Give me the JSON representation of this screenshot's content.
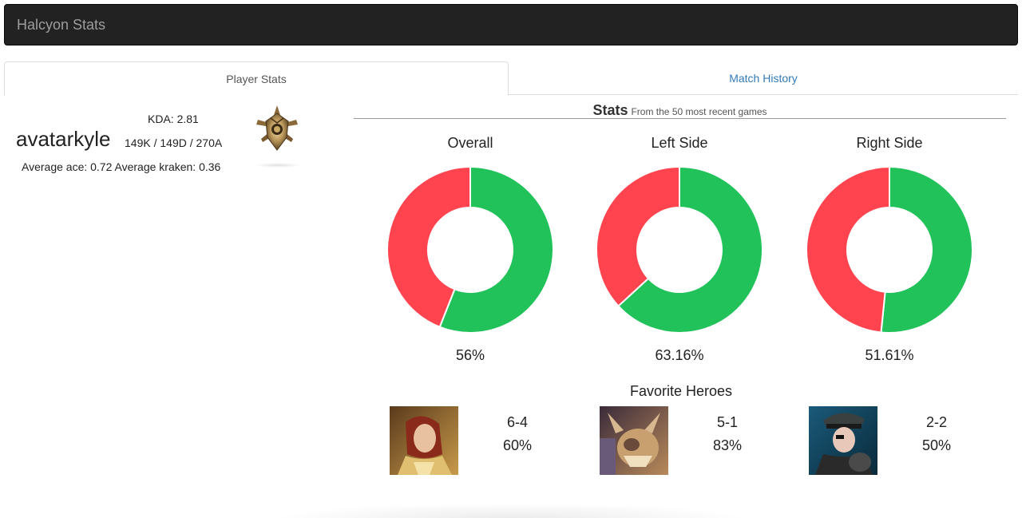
{
  "navbar": {
    "brand": "Halcyon Stats"
  },
  "tabs": [
    {
      "label": "Player Stats",
      "active": true
    },
    {
      "label": "Match History",
      "active": false
    }
  ],
  "player": {
    "name": "avatarkyle",
    "kda": "KDA: 2.81",
    "kills_deaths_assists": "149K / 149D / 270A",
    "averages": "Average ace: 0.72 Average kraken: 0.36",
    "tier_icon": "tier-badge-icon"
  },
  "stats": {
    "title": "Stats",
    "subtitle": "From the 50 most recent games"
  },
  "colors": {
    "win": "#21c25a",
    "loss": "#ff444f"
  },
  "chart_data": [
    {
      "type": "pie",
      "title": "Overall",
      "categories": [
        "Win",
        "Loss"
      ],
      "values": [
        56,
        44
      ],
      "label": "56%"
    },
    {
      "type": "pie",
      "title": "Left Side",
      "categories": [
        "Win",
        "Loss"
      ],
      "values": [
        63.16,
        36.84
      ],
      "label": "63.16%"
    },
    {
      "type": "pie",
      "title": "Right Side",
      "categories": [
        "Win",
        "Loss"
      ],
      "values": [
        51.61,
        48.39
      ],
      "label": "51.61%"
    }
  ],
  "favorite_heroes": {
    "title": "Favorite Heroes",
    "heroes": [
      {
        "record": "6-4",
        "winrate": "60%",
        "icon": "hero-portrait-knight"
      },
      {
        "record": "5-1",
        "winrate": "83%",
        "icon": "hero-portrait-beast"
      },
      {
        "record": "2-2",
        "winrate": "50%",
        "icon": "hero-portrait-officer"
      }
    ]
  }
}
